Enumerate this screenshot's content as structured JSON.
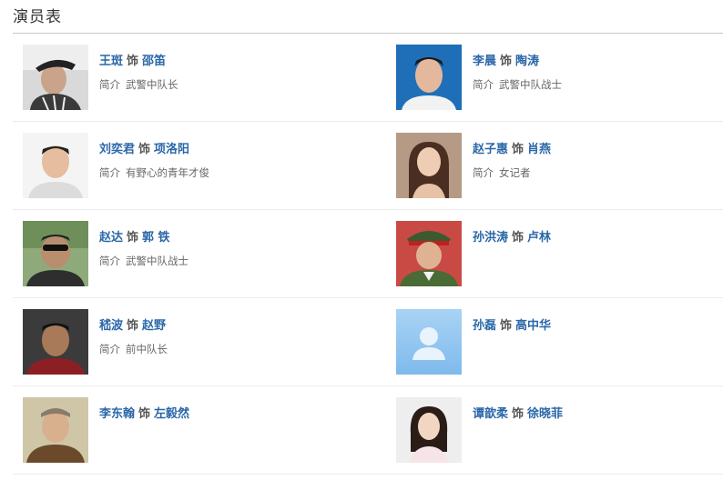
{
  "section_title": "演员表",
  "connector": "饰",
  "intro_label": "简介",
  "cast": [
    {
      "actor": "王斑",
      "role": "邵笛",
      "desc": "武警中队长",
      "photo": "actor-portrait-hat"
    },
    {
      "actor": "李晨",
      "role": "陶涛",
      "desc": "武警中队战士",
      "photo": "actor-portrait-blue-bg"
    },
    {
      "actor": "刘奕君",
      "role": "项洛阳",
      "desc": "有野心的青年才俊",
      "photo": "actor-portrait-smiling"
    },
    {
      "actor": "赵子惠",
      "role": "肖燕",
      "desc": "女记者",
      "photo": "actress-portrait-long-hair"
    },
    {
      "actor": "赵达",
      "role": "郭 铁",
      "desc": "武警中队战士",
      "photo": "actor-portrait-sunglasses"
    },
    {
      "actor": "孙洪涛",
      "role": "卢林",
      "desc": "",
      "photo": "actor-portrait-military-uniform"
    },
    {
      "actor": "嵇波",
      "role": "赵野",
      "desc": "前中队长",
      "photo": "actor-portrait-dark"
    },
    {
      "actor": "孙磊",
      "role": "高中华",
      "desc": "",
      "photo": "placeholder-avatar"
    },
    {
      "actor": "李东翰",
      "role": "左毅然",
      "desc": "",
      "photo": "actor-portrait-qing-costume"
    },
    {
      "actor": "谭歆柔",
      "role": "徐晓菲",
      "desc": "",
      "photo": "actress-portrait-smiling"
    }
  ]
}
